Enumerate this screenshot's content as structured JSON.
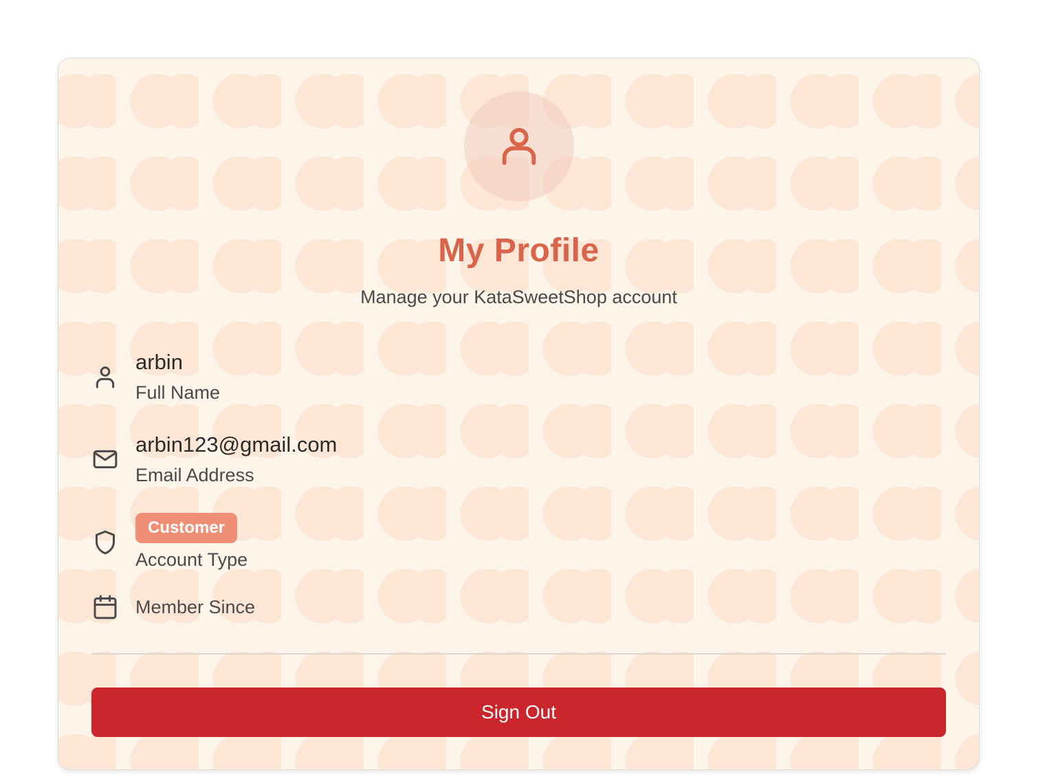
{
  "profile": {
    "title": "My Profile",
    "subtitle": "Manage your KataSweetShop account",
    "avatar_icon": "user-icon"
  },
  "fields": {
    "full_name": {
      "value": "arbin",
      "label": "Full Name",
      "icon": "user-icon"
    },
    "email": {
      "value": "arbin123@gmail.com",
      "label": "Email Address",
      "icon": "mail-icon"
    },
    "account_type": {
      "value": "Customer",
      "label": "Account Type",
      "icon": "shield-icon"
    },
    "member_since": {
      "label": "Member Since",
      "icon": "calendar-icon"
    }
  },
  "actions": {
    "sign_out_label": "Sign Out"
  },
  "colors": {
    "accent": "#d9644a",
    "badge": "#ee8f76",
    "danger": "#cb262e",
    "card_background": "#fdf4ea"
  }
}
